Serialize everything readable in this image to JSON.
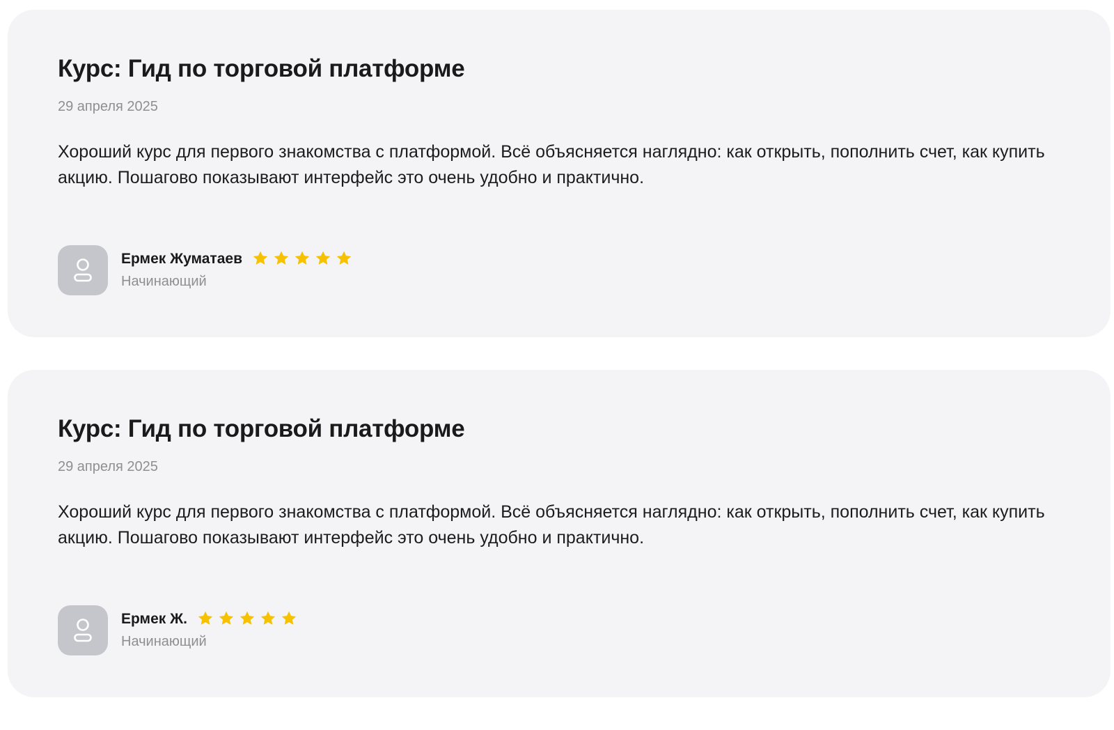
{
  "colors": {
    "card_background": "#f4f4f6",
    "star": "#f6c200",
    "avatar_background": "#c5c6cc",
    "avatar_icon": "#ffffff",
    "muted_text": "#8e8e93"
  },
  "reviews": [
    {
      "course_title": "Курс: Гид по торговой платформе",
      "date": "29 апреля 2025",
      "text": "Хороший курс для первого знакомства с платформой. Всё объясняется наглядно: как открыть, пополнить счет, как купить акцию. Пошагово показывают интерфейс это очень удобно и практично.",
      "author": {
        "name": "Ермек Жуматаев",
        "level": "Начинающий",
        "avatar_icon": "user-icon"
      },
      "rating": 5,
      "rating_max": 5
    },
    {
      "course_title": "Курс: Гид по торговой платформе",
      "date": "29 апреля 2025",
      "text": "Хороший курс для первого знакомства с платформой. Всё объясняется наглядно: как открыть, пополнить счет, как купить акцию. Пошагово показывают интерфейс это очень удобно и практично.",
      "author": {
        "name": "Ермек Ж.",
        "level": "Начинающий",
        "avatar_icon": "user-icon"
      },
      "rating": 5,
      "rating_max": 5
    }
  ]
}
